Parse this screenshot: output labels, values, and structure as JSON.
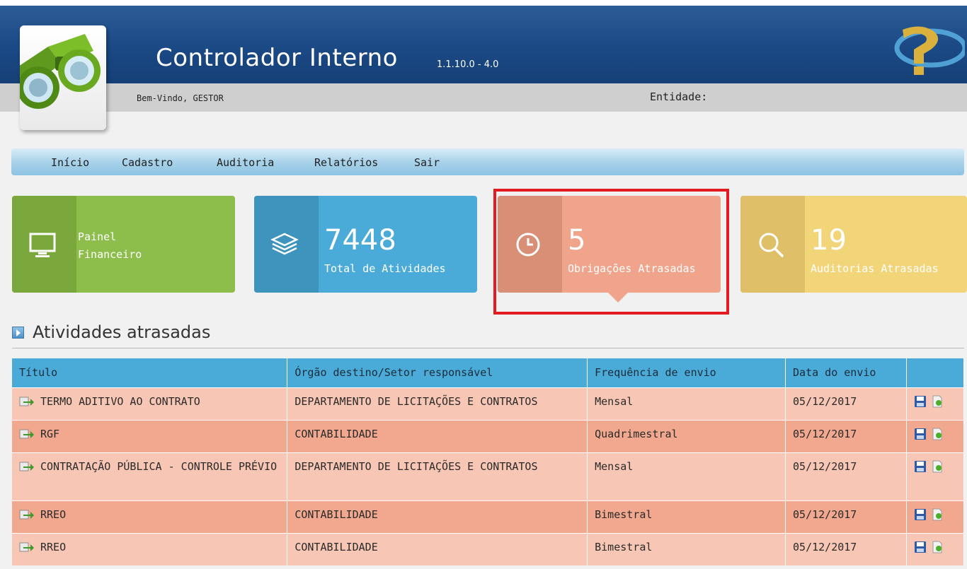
{
  "header": {
    "title": "Controlador Interno",
    "version": "1.1.10.0 - 4.0",
    "welcome": "Bem-Vindo, GESTOR",
    "entity_label": "Entidade:"
  },
  "menu": [
    {
      "label": "Início"
    },
    {
      "label": "Cadastro"
    },
    {
      "label": "Auditoria"
    },
    {
      "label": "Relatórios"
    },
    {
      "label": "Sair"
    }
  ],
  "tiles": {
    "painel": {
      "line1": "Painel",
      "line2": "Financeiro",
      "icon": "monitor-icon",
      "color": "#8dbd4b"
    },
    "atividades": {
      "value": "7448",
      "label": "Total de Atividades",
      "icon": "layers-icon",
      "color": "#4aabd8"
    },
    "obrigacoes": {
      "value": "5",
      "label": "Obrigações Atrasadas",
      "icon": "clock-icon",
      "color": "#f0a48b"
    },
    "auditorias": {
      "value": "19",
      "label": "Auditorias Atrasadas",
      "icon": "search-icon",
      "color": "#f2d479"
    }
  },
  "section": {
    "title": "Atividades atrasadas"
  },
  "table": {
    "headers": [
      "Título",
      "Órgão destino/Setor responsável",
      "Frequência de envio",
      "Data do envio",
      ""
    ],
    "rows": [
      {
        "title": "TERMO ADITIVO AO CONTRATO",
        "orgao": "DEPARTAMENTO DE LICITAÇÕES E CONTRATOS",
        "freq": "Mensal",
        "date": "05/12/2017"
      },
      {
        "title": "RGF",
        "orgao": "CONTABILIDADE",
        "freq": "Quadrimestral",
        "date": "05/12/2017"
      },
      {
        "title": "CONTRATAÇÃO PÚBLICA - CONTROLE PRÉVIO",
        "orgao": "DEPARTAMENTO DE LICITAÇÕES E CONTRATOS",
        "freq": "Mensal",
        "date": "05/12/2017"
      },
      {
        "title": "RREO",
        "orgao": "CONTABILIDADE",
        "freq": "Bimestral",
        "date": "05/12/2017"
      },
      {
        "title": "RREO",
        "orgao": "CONTABILIDADE",
        "freq": "Bimestral",
        "date": "05/12/2017"
      }
    ]
  },
  "colors": {
    "header_blue": "#1b4a86",
    "overdue_row_light": "#f8c6b4",
    "overdue_row_dark": "#f1a88e",
    "highlight_red": "#e41b23"
  }
}
